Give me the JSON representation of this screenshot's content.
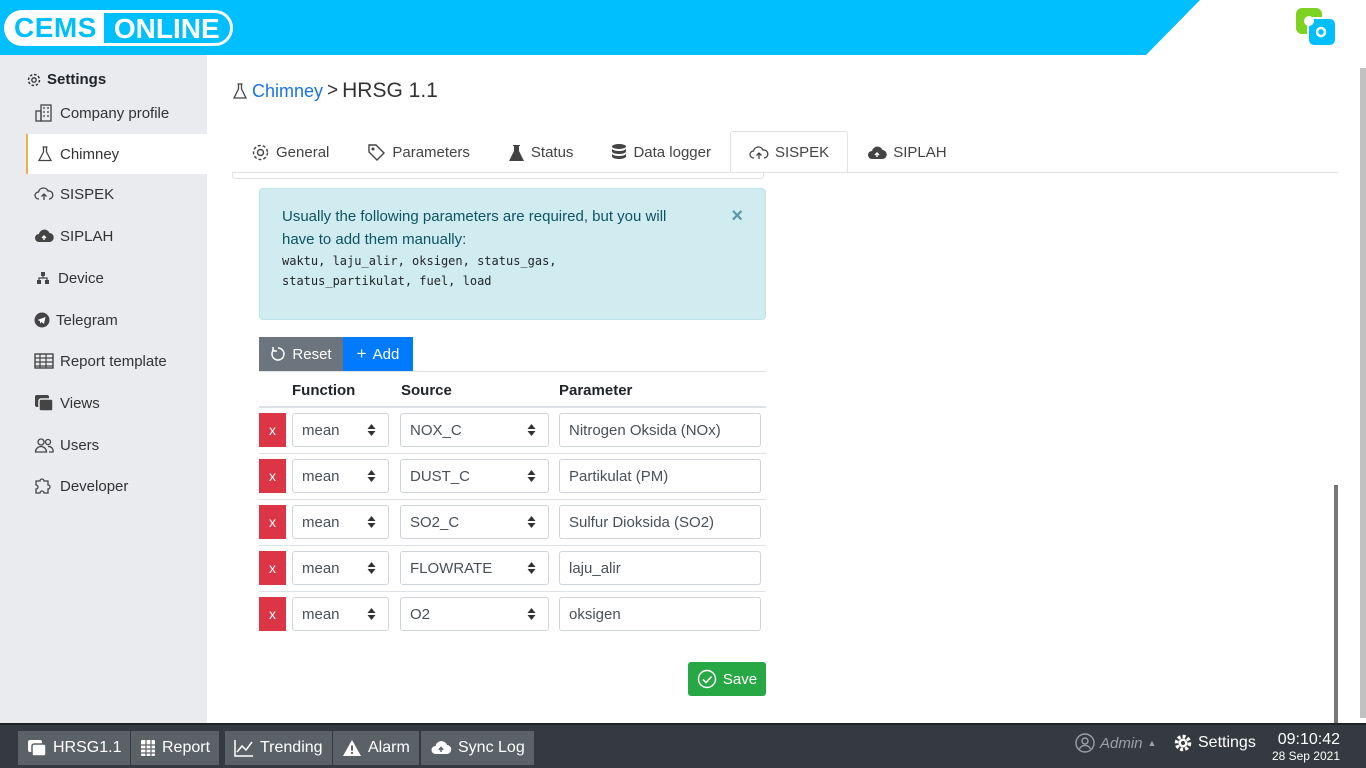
{
  "header": {
    "logo_part1": "CEMS",
    "logo_part2": "ONLINE",
    "app_icon": "app-grid-icon"
  },
  "sidebar": {
    "title": "Settings",
    "items": [
      {
        "label": "Company profile",
        "icon": "building-icon"
      },
      {
        "label": "Chimney",
        "icon": "flask-icon",
        "active": true
      },
      {
        "label": "SISPEK",
        "icon": "cloud-upload-outline-icon"
      },
      {
        "label": "SIPLAH",
        "icon": "cloud-upload-icon"
      },
      {
        "label": "Device",
        "icon": "diagram-icon"
      },
      {
        "label": "Telegram",
        "icon": "telegram-icon"
      },
      {
        "label": "Report template",
        "icon": "table-icon"
      },
      {
        "label": "Views",
        "icon": "window-icon"
      },
      {
        "label": "Users",
        "icon": "users-icon"
      },
      {
        "label": "Developer",
        "icon": "puzzle-icon"
      }
    ]
  },
  "breadcrumb": {
    "parent": "Chimney",
    "separator": ">",
    "current": "HRSG 1.1"
  },
  "tabs": [
    {
      "label": "General",
      "icon": "gear-icon"
    },
    {
      "label": "Parameters",
      "icon": "tag-icon"
    },
    {
      "label": "Status",
      "icon": "flask-icon"
    },
    {
      "label": "Data logger",
      "icon": "database-icon"
    },
    {
      "label": "SISPEK",
      "icon": "cloud-upload-outline-icon",
      "active": true
    },
    {
      "label": "SIPLAH",
      "icon": "cloud-upload-icon"
    }
  ],
  "alert": {
    "text": "Usually the following parameters are required, but you will have to add them manually:",
    "code": "waktu, laju_alir, oksigen, status_gas, status_partikulat, fuel, load",
    "close": "×"
  },
  "buttons": {
    "reset": "Reset",
    "add": "Add",
    "save": "Save",
    "delete": "x"
  },
  "table": {
    "headers": [
      "Function",
      "Source",
      "Parameter"
    ],
    "rows": [
      {
        "function": "mean",
        "source": "NOX_C",
        "parameter": "Nitrogen Oksida (NOx)"
      },
      {
        "function": "mean",
        "source": "DUST_C",
        "parameter": "Partikulat (PM)"
      },
      {
        "function": "mean",
        "source": "SO2_C",
        "parameter": "Sulfur Dioksida (SO2)"
      },
      {
        "function": "mean",
        "source": "FLOWRATE",
        "parameter": "laju_alir"
      },
      {
        "function": "mean",
        "source": "O2",
        "parameter": "oksigen"
      }
    ]
  },
  "taskbar": {
    "buttons": [
      {
        "label": "HRSG1.1",
        "icon": "window-icon"
      },
      {
        "label": "Report",
        "icon": "report-icon"
      },
      {
        "label": "Trending",
        "icon": "chart-icon"
      },
      {
        "label": "Alarm",
        "icon": "warning-icon"
      },
      {
        "label": "Sync Log",
        "icon": "cloud-upload-icon"
      }
    ],
    "user": "Admin",
    "settings": "Settings",
    "time": "09:10:42",
    "date": "28 Sep 2021"
  },
  "colors": {
    "header": "#00bfff",
    "danger": "#dc3545",
    "primary": "#007bff",
    "success": "#28a745",
    "info_bg": "#d1ecf1"
  }
}
